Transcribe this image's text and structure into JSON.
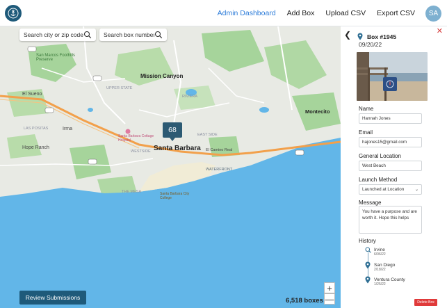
{
  "nav": {
    "items": [
      {
        "label": "Admin Dashboard",
        "active": true
      },
      {
        "label": "Add Box",
        "active": false
      },
      {
        "label": "Upload CSV",
        "active": false
      },
      {
        "label": "Export CSV",
        "active": false
      }
    ],
    "avatar_initials": "SA"
  },
  "search": {
    "city_placeholder": "Search city or zip code",
    "box_placeholder": "Search box number"
  },
  "map": {
    "cluster_count": "68",
    "labels": {
      "mission_canyon": "Mission Canyon",
      "santa_barbara": "Santa Barbara",
      "montecito": "Montecito",
      "el_sueno": "El Sueno",
      "hope_ranch": "Hope Ranch",
      "las_positas": "LAS POSITAS",
      "irma": "Irma",
      "upper_state": "UPPER STATE",
      "westside": "WESTSIDE",
      "the_mesa": "THE MESA",
      "riviera": "RIVIERA",
      "east_side": "EAST SIDE",
      "waterfront": "WATERFRONT",
      "san_marcos": "San Marcos Foothills Preserve",
      "cottage_hospital": "Santa Barbara Cottage Hospital",
      "city_college": "Santa Barbara City College",
      "el_camino_real": "El Camino Real",
      "mission_canyon_rd": "Mission Canyon Rd"
    },
    "review_label": "Review Submissions",
    "box_count_label": "6,518 boxes",
    "zoom_in": "+",
    "zoom_out": "—"
  },
  "panel": {
    "box_title": "Box #1945",
    "box_date": "09/20/22",
    "name_label": "Name",
    "name_value": "Hannah Jones",
    "email_label": "Email",
    "email_value": "hajones15@gmail.com",
    "location_label": "General Location",
    "location_value": "West Beach",
    "launch_label": "Launch Method",
    "launch_value": "Launched at Location",
    "message_label": "Message",
    "message_value": "You have a purpose and are worth it. Hope this helps",
    "history_label": "History",
    "history": [
      {
        "place": "Irvine",
        "date": "6/06/22",
        "icon": "search-icon"
      },
      {
        "place": "San Diego",
        "date": "2/18/22",
        "icon": "map-pin-icon"
      },
      {
        "place": "Ventura County",
        "date": "1/25/22",
        "icon": "map-pin-icon"
      }
    ],
    "delete_label": "Delete Box"
  },
  "colors": {
    "primary": "#1e5a7a",
    "accent": "#2b7bd9",
    "danger": "#e03a3a",
    "ocean": "#62b6e8",
    "park": "#a6d49b",
    "highway": "#f2a04b"
  }
}
